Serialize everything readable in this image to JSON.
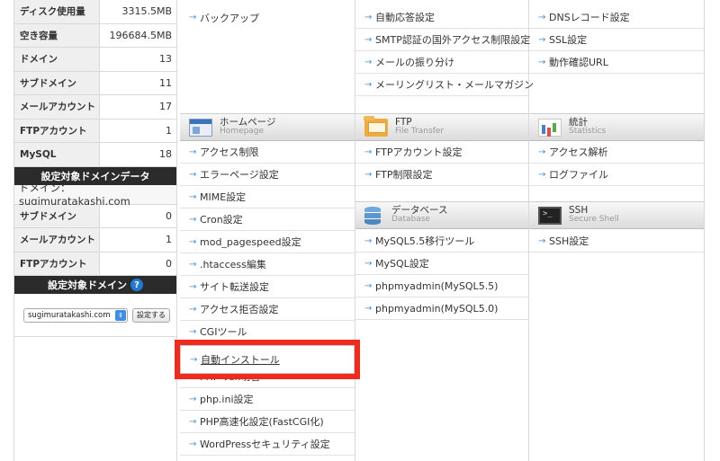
{
  "sidebar": {
    "stats": [
      {
        "label": "ディスク使用量",
        "value": "3315.5MB"
      },
      {
        "label": "空き容量",
        "value": "196684.5MB"
      },
      {
        "label": "ドメイン",
        "value": "13"
      },
      {
        "label": "サブドメイン",
        "value": "11"
      },
      {
        "label": "メールアカウント",
        "value": "17"
      },
      {
        "label": "FTPアカウント",
        "value": "1"
      },
      {
        "label": "MySQL",
        "value": "18"
      }
    ],
    "target_data_heading": "設定対象ドメインデータ",
    "domain_line": "ドメイン： sugimuratakashi.com",
    "domain_stats": [
      {
        "label": "サブドメイン",
        "value": "0"
      },
      {
        "label": "メールアカウント",
        "value": "1"
      },
      {
        "label": "FTPアカウント",
        "value": "0"
      }
    ],
    "target_domain_heading": "設定対象ドメイン",
    "help_glyph": "?",
    "selected_domain": "sugimuratakashi.com",
    "set_button": "設定する"
  },
  "col1": {
    "top_items": [
      "バックアップ"
    ],
    "section": {
      "title": "ホームページ",
      "subtitle": "Homepage",
      "icon": "homepage-icon"
    },
    "items": [
      "アクセス制限",
      "エラーページ設定",
      "MIME設定",
      "Cron設定",
      "mod_pagespeed設定",
      ".htaccess編集",
      "サイト転送設定",
      "アクセス拒否設定",
      "CGIツール",
      "自動インストール",
      "PHP Ver.切替",
      "php.ini設定",
      "PHP高速化設定(FastCGI化)",
      "WordPressセキュリティ設定"
    ]
  },
  "col2": {
    "top_items": [
      "自動応答設定",
      "SMTP認証の国外アクセス制限設定",
      "メールの振り分け",
      "メーリングリスト・メールマガジン"
    ],
    "section1": {
      "title": "FTP",
      "subtitle": "File Transfer",
      "icon": "ftp-folder-icon"
    },
    "items1": [
      "FTPアカウント設定",
      "FTP制限設定"
    ],
    "section2": {
      "title": "データベース",
      "subtitle": "Database",
      "icon": "database-icon"
    },
    "items2": [
      "MySQL5.5移行ツール",
      "MySQL設定",
      "phpmyadmin(MySQL5.5)",
      "phpmyadmin(MySQL5.0)"
    ]
  },
  "col3": {
    "top_items": [
      "DNSレコード設定",
      "SSL設定",
      "動作確認URL"
    ],
    "section1": {
      "title": "統計",
      "subtitle": "Statistics",
      "icon": "statistics-chart-icon"
    },
    "items1": [
      "アクセス解析",
      "ログファイル"
    ],
    "section2": {
      "title": "SSH",
      "subtitle": "Secure Shell",
      "icon": "terminal-icon"
    },
    "items2": [
      "SSH設定"
    ]
  },
  "arrow_glyph": "→",
  "highlight_color": "#f02b1d"
}
